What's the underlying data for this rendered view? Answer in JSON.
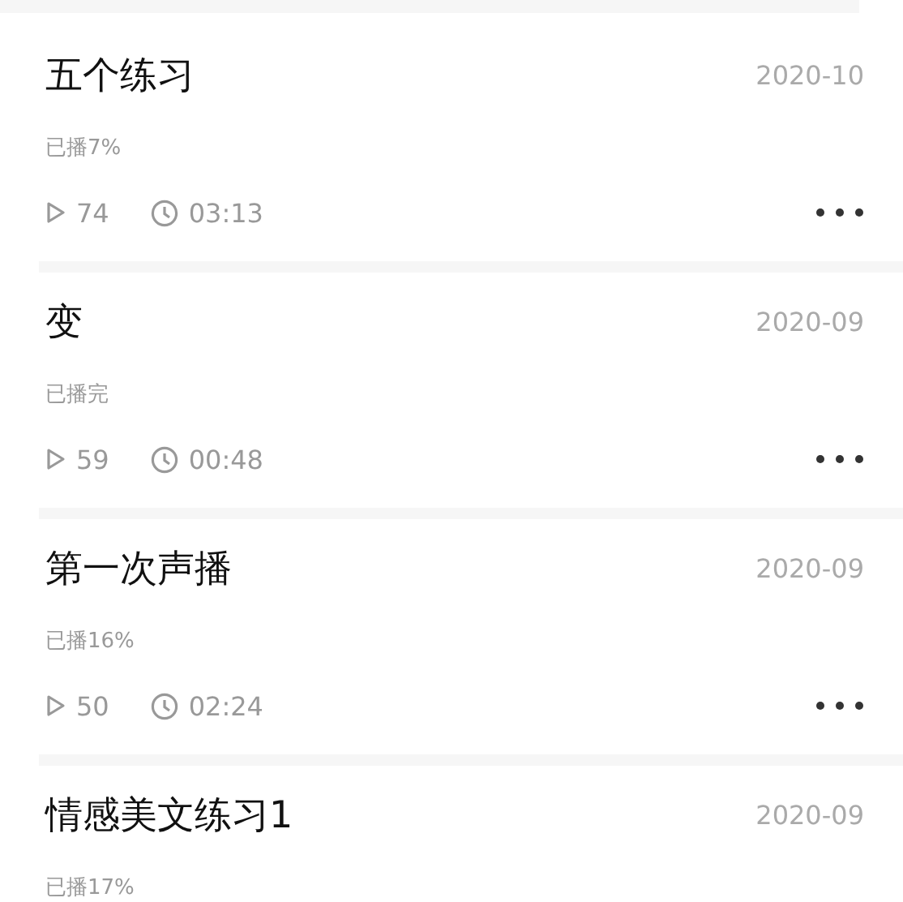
{
  "items": [
    {
      "title": "五个练习",
      "date": "2020-10",
      "status": "已播7%",
      "plays": "74",
      "duration": "03:13"
    },
    {
      "title": "变",
      "date": "2020-09",
      "status": "已播完",
      "plays": "59",
      "duration": "00:48"
    },
    {
      "title": "第一次声播",
      "date": "2020-09",
      "status": "已播16%",
      "plays": "50",
      "duration": "02:24"
    },
    {
      "title": "情感美文练习1",
      "date": "2020-09",
      "status": "已播17%"
    }
  ]
}
